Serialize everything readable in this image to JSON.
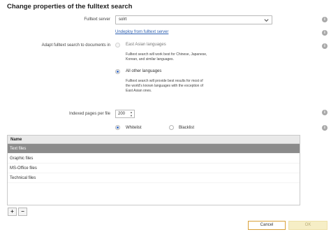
{
  "dialog": {
    "title": "Change properties of the fulltext search"
  },
  "fulltext_server": {
    "label": "Fulltext server",
    "value": "solrt",
    "undeploy_link": "Undeploy from fulltext server"
  },
  "adapt": {
    "label": "Adapt fulltext search to documents in",
    "options": [
      {
        "label": "East Asian languages",
        "desc": "Fulltext search will work best for Chinese, Japanese, Korean, and similar languages.",
        "selected": false,
        "disabled": true
      },
      {
        "label": "All other languages",
        "desc": "Fulltext search will provide best results for most of the world's known languages with the exception of East Asian ones.",
        "selected": true,
        "disabled": false
      }
    ]
  },
  "indexed_pages": {
    "label": "Indexed pages per file",
    "value": "200"
  },
  "list_mode": [
    {
      "label": "Whitelist",
      "selected": true
    },
    {
      "label": "Blacklist",
      "selected": false
    }
  ],
  "table": {
    "header": "Name",
    "rows": [
      "Text files",
      "Graphic files",
      "MS-Office files",
      "Technical files"
    ],
    "selected_index": 0
  },
  "table_buttons": {
    "add": "+",
    "remove": "−"
  },
  "footer": {
    "cancel": "Cancel",
    "ok": "OK"
  },
  "icons": {
    "info": "info-icon",
    "dropdown": "chevron-down-icon"
  },
  "colors": {
    "accent": "#3d6fc7",
    "link": "#2a5db0",
    "selected_row": "#8b8b8b",
    "cancel_border": "#d9a13a",
    "ok_bg": "#f6eec6"
  }
}
